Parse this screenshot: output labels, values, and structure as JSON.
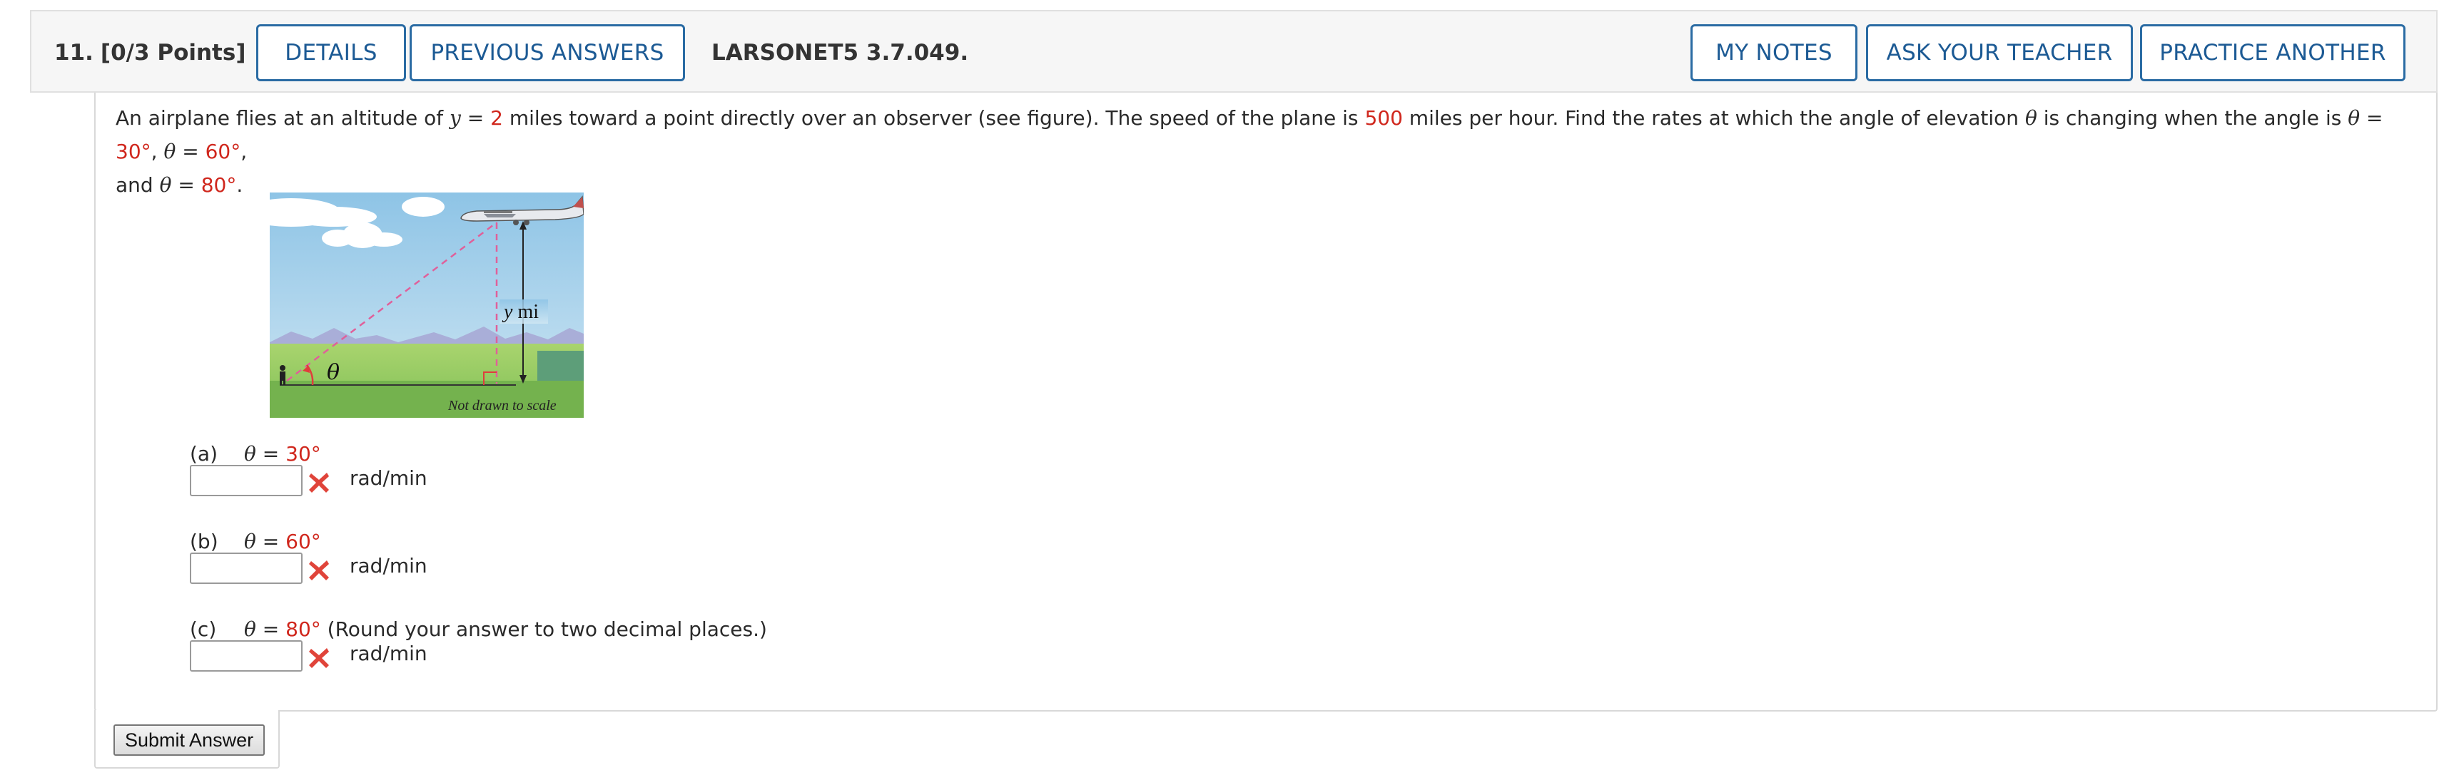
{
  "header": {
    "number": "11.",
    "points": "[0/3 Points]",
    "details_label": "DETAILS",
    "previous_answers_label": "PREVIOUS ANSWERS",
    "code": "LARSONET5 3.7.049.",
    "my_notes_label": "MY NOTES",
    "ask_teacher_label": "ASK YOUR TEACHER",
    "practice_another_label": "PRACTICE ANOTHER"
  },
  "problem": {
    "t1": "An airplane flies at an altitude of ",
    "y_var": "y",
    "eq": " = ",
    "y_value": "2",
    "t2": " miles toward a point directly over an observer (see figure). The speed of the plane is ",
    "speed": "500",
    "t3": " miles per hour. Find the rates at which the angle of elevation ",
    "theta": "θ",
    "t4": " is changing when the angle is ",
    "a1": "30°",
    "a2": "60°",
    "and": "and ",
    "a3": "80°",
    "comma": ", ",
    "period": "."
  },
  "figure": {
    "theta_label": "θ",
    "y_label_var": "y",
    "y_label_unit": " mi",
    "note": "Not drawn to scale"
  },
  "parts": [
    {
      "letter": "(a)",
      "theta": "θ",
      "eq": " = ",
      "angle": "30°",
      "note": "",
      "unit": "rad/min",
      "value": ""
    },
    {
      "letter": "(b)",
      "theta": "θ",
      "eq": " = ",
      "angle": "60°",
      "note": "",
      "unit": "rad/min",
      "value": ""
    },
    {
      "letter": "(c)",
      "theta": "θ",
      "eq": " = ",
      "angle": "80°",
      "note": " (Round your answer to two decimal places.)",
      "unit": "rad/min",
      "value": ""
    }
  ],
  "submit_label": "Submit Answer",
  "colors": {
    "accent": "#2a6ba3",
    "highlight_red": "#d0271d",
    "wrong_x": "#e0443a"
  },
  "icons": {
    "wrong": "x-mark-icon"
  }
}
